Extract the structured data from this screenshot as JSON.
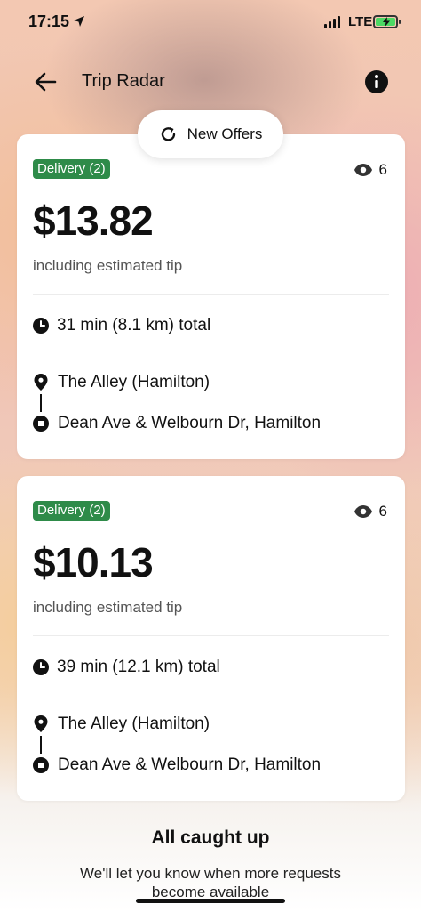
{
  "status_bar": {
    "time": "17:15",
    "network": "LTE"
  },
  "header": {
    "title": "Trip Radar"
  },
  "refresh": {
    "label": "New Offers"
  },
  "offers": [
    {
      "badge": "Delivery (2)",
      "views": "6",
      "price": "$13.82",
      "tip_note": "including estimated tip",
      "duration": "31 min (8.1 km) total",
      "pickup": "The Alley (Hamilton)",
      "dropoff": "Dean Ave & Welbourn Dr, Hamilton"
    },
    {
      "badge": "Delivery (2)",
      "views": "6",
      "price": "$10.13",
      "tip_note": "including estimated tip",
      "duration": "39 min (12.1 km) total",
      "pickup": "The Alley (Hamilton)",
      "dropoff": "Dean Ave & Welbourn Dr, Hamilton"
    }
  ],
  "footer": {
    "title": "All caught up",
    "subtitle": "We'll let you know when more requests become available"
  },
  "colors": {
    "badge": "#2e8b49",
    "battery": "#4cd964"
  },
  "icons": [
    "location-arrow-icon",
    "signal-icon",
    "battery-icon",
    "back-arrow-icon",
    "info-icon",
    "refresh-icon",
    "eye-icon",
    "clock-icon",
    "pin-icon",
    "square-stop-icon"
  ]
}
